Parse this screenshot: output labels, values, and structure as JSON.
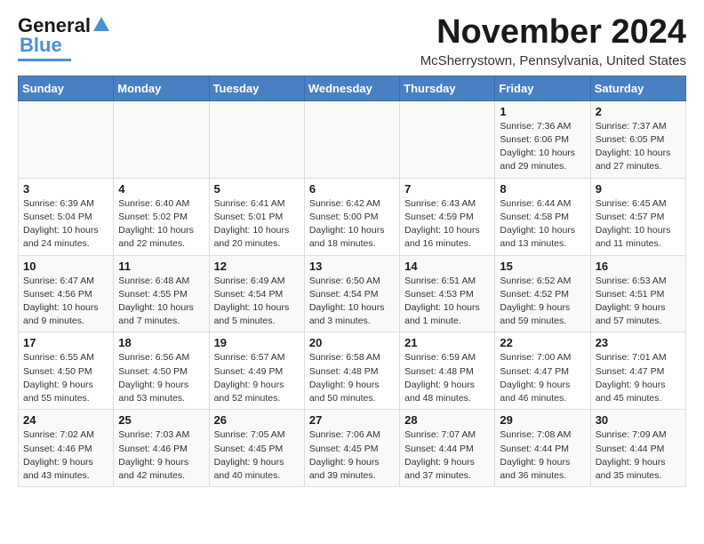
{
  "header": {
    "logo_general": "General",
    "logo_blue": "Blue",
    "month_title": "November 2024",
    "location": "McSherrystown, Pennsylvania, United States"
  },
  "weekdays": [
    "Sunday",
    "Monday",
    "Tuesday",
    "Wednesday",
    "Thursday",
    "Friday",
    "Saturday"
  ],
  "weeks": [
    [
      {
        "day": "",
        "info": ""
      },
      {
        "day": "",
        "info": ""
      },
      {
        "day": "",
        "info": ""
      },
      {
        "day": "",
        "info": ""
      },
      {
        "day": "",
        "info": ""
      },
      {
        "day": "1",
        "info": "Sunrise: 7:36 AM\nSunset: 6:06 PM\nDaylight: 10 hours and 29 minutes."
      },
      {
        "day": "2",
        "info": "Sunrise: 7:37 AM\nSunset: 6:05 PM\nDaylight: 10 hours and 27 minutes."
      }
    ],
    [
      {
        "day": "3",
        "info": "Sunrise: 6:39 AM\nSunset: 5:04 PM\nDaylight: 10 hours and 24 minutes."
      },
      {
        "day": "4",
        "info": "Sunrise: 6:40 AM\nSunset: 5:02 PM\nDaylight: 10 hours and 22 minutes."
      },
      {
        "day": "5",
        "info": "Sunrise: 6:41 AM\nSunset: 5:01 PM\nDaylight: 10 hours and 20 minutes."
      },
      {
        "day": "6",
        "info": "Sunrise: 6:42 AM\nSunset: 5:00 PM\nDaylight: 10 hours and 18 minutes."
      },
      {
        "day": "7",
        "info": "Sunrise: 6:43 AM\nSunset: 4:59 PM\nDaylight: 10 hours and 16 minutes."
      },
      {
        "day": "8",
        "info": "Sunrise: 6:44 AM\nSunset: 4:58 PM\nDaylight: 10 hours and 13 minutes."
      },
      {
        "day": "9",
        "info": "Sunrise: 6:45 AM\nSunset: 4:57 PM\nDaylight: 10 hours and 11 minutes."
      }
    ],
    [
      {
        "day": "10",
        "info": "Sunrise: 6:47 AM\nSunset: 4:56 PM\nDaylight: 10 hours and 9 minutes."
      },
      {
        "day": "11",
        "info": "Sunrise: 6:48 AM\nSunset: 4:55 PM\nDaylight: 10 hours and 7 minutes."
      },
      {
        "day": "12",
        "info": "Sunrise: 6:49 AM\nSunset: 4:54 PM\nDaylight: 10 hours and 5 minutes."
      },
      {
        "day": "13",
        "info": "Sunrise: 6:50 AM\nSunset: 4:54 PM\nDaylight: 10 hours and 3 minutes."
      },
      {
        "day": "14",
        "info": "Sunrise: 6:51 AM\nSunset: 4:53 PM\nDaylight: 10 hours and 1 minute."
      },
      {
        "day": "15",
        "info": "Sunrise: 6:52 AM\nSunset: 4:52 PM\nDaylight: 9 hours and 59 minutes."
      },
      {
        "day": "16",
        "info": "Sunrise: 6:53 AM\nSunset: 4:51 PM\nDaylight: 9 hours and 57 minutes."
      }
    ],
    [
      {
        "day": "17",
        "info": "Sunrise: 6:55 AM\nSunset: 4:50 PM\nDaylight: 9 hours and 55 minutes."
      },
      {
        "day": "18",
        "info": "Sunrise: 6:56 AM\nSunset: 4:50 PM\nDaylight: 9 hours and 53 minutes."
      },
      {
        "day": "19",
        "info": "Sunrise: 6:57 AM\nSunset: 4:49 PM\nDaylight: 9 hours and 52 minutes."
      },
      {
        "day": "20",
        "info": "Sunrise: 6:58 AM\nSunset: 4:48 PM\nDaylight: 9 hours and 50 minutes."
      },
      {
        "day": "21",
        "info": "Sunrise: 6:59 AM\nSunset: 4:48 PM\nDaylight: 9 hours and 48 minutes."
      },
      {
        "day": "22",
        "info": "Sunrise: 7:00 AM\nSunset: 4:47 PM\nDaylight: 9 hours and 46 minutes."
      },
      {
        "day": "23",
        "info": "Sunrise: 7:01 AM\nSunset: 4:47 PM\nDaylight: 9 hours and 45 minutes."
      }
    ],
    [
      {
        "day": "24",
        "info": "Sunrise: 7:02 AM\nSunset: 4:46 PM\nDaylight: 9 hours and 43 minutes."
      },
      {
        "day": "25",
        "info": "Sunrise: 7:03 AM\nSunset: 4:46 PM\nDaylight: 9 hours and 42 minutes."
      },
      {
        "day": "26",
        "info": "Sunrise: 7:05 AM\nSunset: 4:45 PM\nDaylight: 9 hours and 40 minutes."
      },
      {
        "day": "27",
        "info": "Sunrise: 7:06 AM\nSunset: 4:45 PM\nDaylight: 9 hours and 39 minutes."
      },
      {
        "day": "28",
        "info": "Sunrise: 7:07 AM\nSunset: 4:44 PM\nDaylight: 9 hours and 37 minutes."
      },
      {
        "day": "29",
        "info": "Sunrise: 7:08 AM\nSunset: 4:44 PM\nDaylight: 9 hours and 36 minutes."
      },
      {
        "day": "30",
        "info": "Sunrise: 7:09 AM\nSunset: 4:44 PM\nDaylight: 9 hours and 35 minutes."
      }
    ]
  ]
}
